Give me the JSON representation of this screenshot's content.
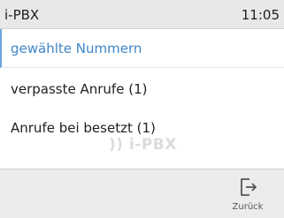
{
  "status": {
    "title": "i-PBX",
    "time": "11:05"
  },
  "menu": {
    "items": [
      {
        "label": "gewählte Nummern",
        "selected": true
      },
      {
        "label": "verpasste Anrufe (1)",
        "selected": false
      },
      {
        "label": "Anrufe bei besetzt (1)",
        "selected": false
      }
    ]
  },
  "watermark": {
    "text": ")) i-PBX"
  },
  "softkeys": {
    "back_label": "Zurück",
    "back_icon": "exit-icon"
  },
  "colors": {
    "accent": "#3f87c8",
    "status_bar_bg": "#e8e8e8",
    "bottom_bar_bg": "#ececec"
  }
}
